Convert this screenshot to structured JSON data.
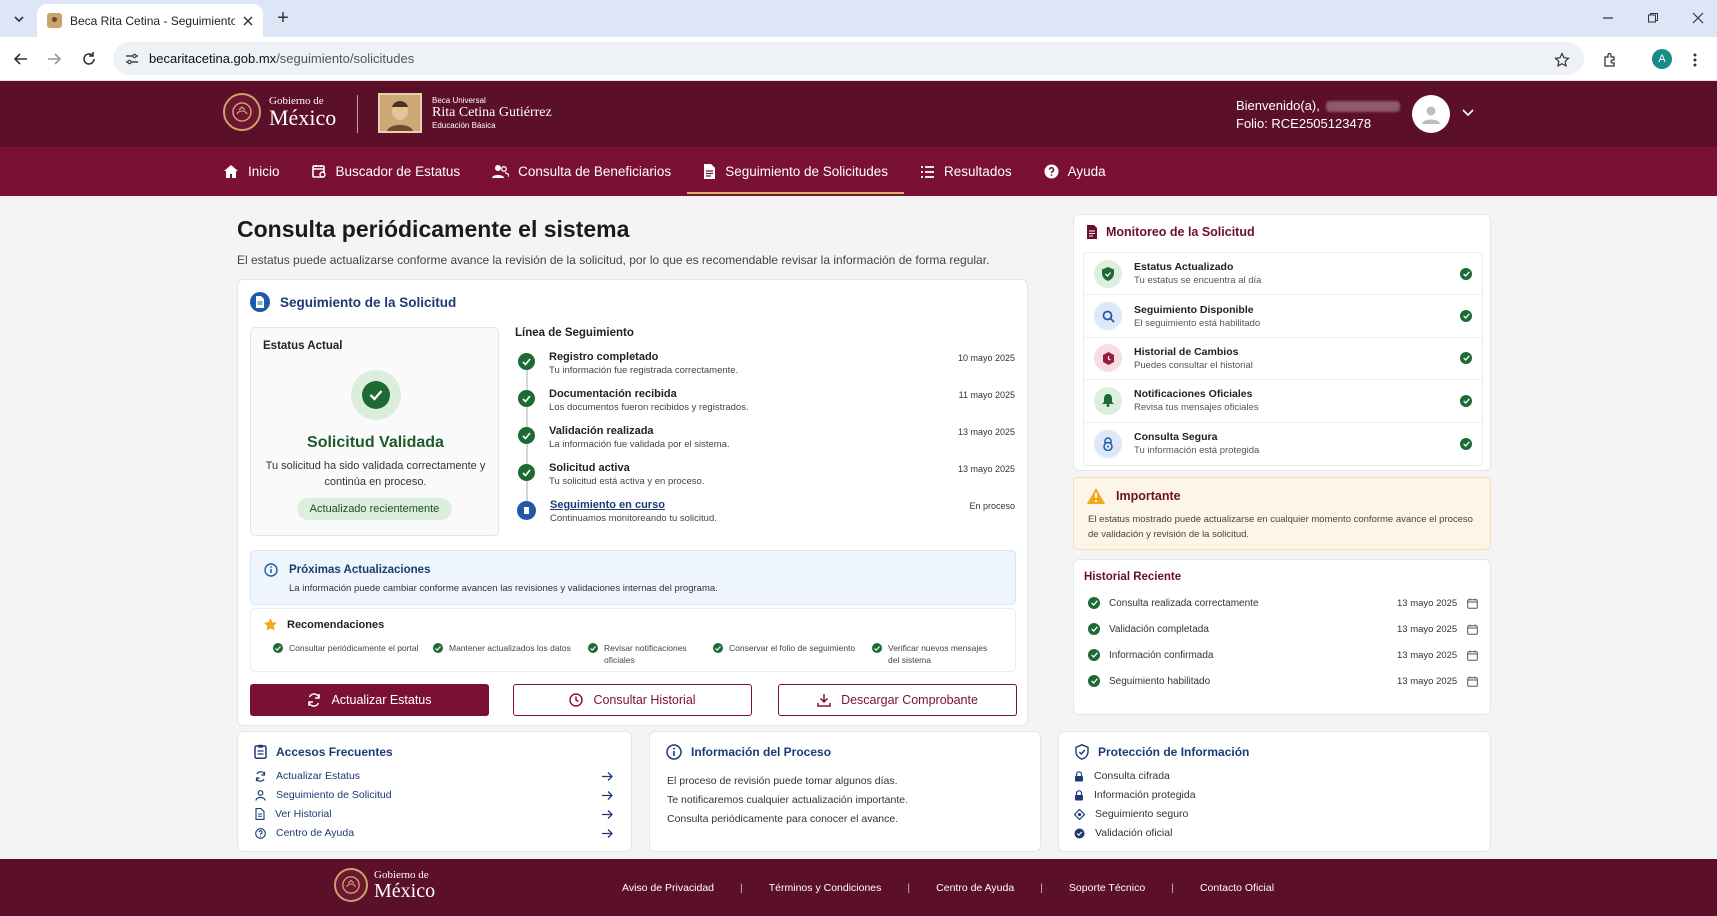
{
  "browser": {
    "tab_title": "Beca Rita Cetina - Seguimiento de",
    "url_domain": "becaritacetina.gob.mx",
    "url_path": "/seguimiento/solicitudes",
    "profile_initial": "A"
  },
  "header": {
    "gob_small": "Gobierno de",
    "gob_big": "México",
    "beca_small": "Beca Universal",
    "beca_name": "Rita Cetina Gutiérrez",
    "beca_level": "Educación Básica",
    "welcome": "Bienvenido(a),",
    "folio": "Folio: RCE2505123478"
  },
  "nav": [
    {
      "label": "Inicio",
      "icon": "home-icon"
    },
    {
      "label": "Buscador de Estatus",
      "icon": "calendar-search-icon"
    },
    {
      "label": "Consulta de Beneficiarios",
      "icon": "users-icon"
    },
    {
      "label": "Seguimiento de Solicitudes",
      "icon": "document-icon"
    },
    {
      "label": "Resultados",
      "icon": "list-icon"
    },
    {
      "label": "Ayuda",
      "icon": "help-icon"
    }
  ],
  "page": {
    "title": "Consulta periódicamente el sistema",
    "subtitle": "El estatus puede actualizarse conforme avance la revisión de la solicitud, por lo que es recomendable revisar la información de forma regular."
  },
  "seguimiento": {
    "title": "Seguimiento de la Solicitud",
    "estatus_label": "Estatus Actual",
    "status_title": "Solicitud Validada",
    "status_desc": "Tu solicitud ha sido validada correctamente y continúa en proceso.",
    "status_pill": "Actualizado recientemente",
    "timeline_label": "Línea de Seguimiento",
    "timeline": [
      {
        "title": "Registro completado",
        "desc": "Tu información fue registrada correctamente.",
        "date": "10 mayo 2025"
      },
      {
        "title": "Documentación recibida",
        "desc": "Los documentos fueron recibidos y registrados.",
        "date": "11 mayo 2025"
      },
      {
        "title": "Validación realizada",
        "desc": "La información fue validada por el sistema.",
        "date": "13 mayo 2025"
      },
      {
        "title": "Solicitud activa",
        "desc": "Tu solicitud está activa y en proceso.",
        "date": "13 mayo 2025"
      },
      {
        "title": "Seguimiento en curso",
        "desc": "Continuamos monitoreando tu solicitud.",
        "date": "En proceso"
      }
    ],
    "proximas_title": "Próximas Actualizaciones",
    "proximas_desc": "La información puede cambiar conforme avancen las revisiones y validaciones internas del programa.",
    "rec_title": "Recomendaciones",
    "recs": [
      "Consultar periódicamente el portal",
      "Mantener actualizados los datos",
      "Revisar notificaciones oficiales",
      "Conservar el folio de seguimiento",
      "Verificar nuevos mensajes del sistema"
    ],
    "btn_update": "Actualizar Estatus",
    "btn_history": "Consultar Historial",
    "btn_download": "Descargar Comprobante"
  },
  "monitoreo": {
    "title": "Monitoreo de la Solicitud",
    "items": [
      {
        "title": "Estatus Actualizado",
        "desc": "Tu estatus se encuentra al día",
        "icon": "shield-check-icon",
        "bg": "#dcefdf",
        "fg": "#1e6a34"
      },
      {
        "title": "Seguimiento Disponible",
        "desc": "El seguimiento está habilitado",
        "icon": "search-icon",
        "bg": "#dde8f6",
        "fg": "#1f5aa6"
      },
      {
        "title": "Historial de Cambios",
        "desc": "Puedes consultar el historial",
        "icon": "history-icon",
        "bg": "#f6dde3",
        "fg": "#9b1c3d"
      },
      {
        "title": "Notificaciones Oficiales",
        "desc": "Revisa tus mensajes oficiales",
        "icon": "bell-icon",
        "bg": "#dcefdf",
        "fg": "#1e6a34"
      },
      {
        "title": "Consulta Segura",
        "desc": "Tu información está protegida",
        "icon": "lock-icon",
        "bg": "#dde8f6",
        "fg": "#1f5aa6"
      }
    ]
  },
  "importante": {
    "title": "Importante",
    "desc": "El estatus mostrado puede actualizarse en cualquier momento conforme avance el proceso de validación y revisión de la solicitud."
  },
  "historial": {
    "title": "Historial Reciente",
    "items": [
      {
        "label": "Consulta realizada correctamente",
        "date": "13 mayo 2025"
      },
      {
        "label": "Validación completada",
        "date": "13 mayo 2025"
      },
      {
        "label": "Información confirmada",
        "date": "13 mayo 2025"
      },
      {
        "label": "Seguimiento habilitado",
        "date": "13 mayo 2025"
      }
    ]
  },
  "accesos": {
    "title": "Accesos Frecuentes",
    "links": [
      "Actualizar Estatus",
      "Seguimiento de Solicitud",
      "Ver Historial",
      "Centro de Ayuda"
    ]
  },
  "proceso": {
    "title": "Información del Proceso",
    "lines": [
      "El proceso de revisión puede tomar algunos días.",
      "Te notificaremos cualquier actualización importante.",
      "Consulta periódicamente para conocer el avance."
    ]
  },
  "proteccion": {
    "title": "Protección de Información",
    "items": [
      "Consulta cifrada",
      "Información protegida",
      "Seguimiento seguro",
      "Validación oficial"
    ]
  },
  "footer": {
    "gob_small": "Gobierno de",
    "gob_big": "México",
    "links": [
      "Aviso de Privacidad",
      "Términos y Condiciones",
      "Centro de Ayuda",
      "Soporte Técnico",
      "Contacto Oficial"
    ]
  }
}
